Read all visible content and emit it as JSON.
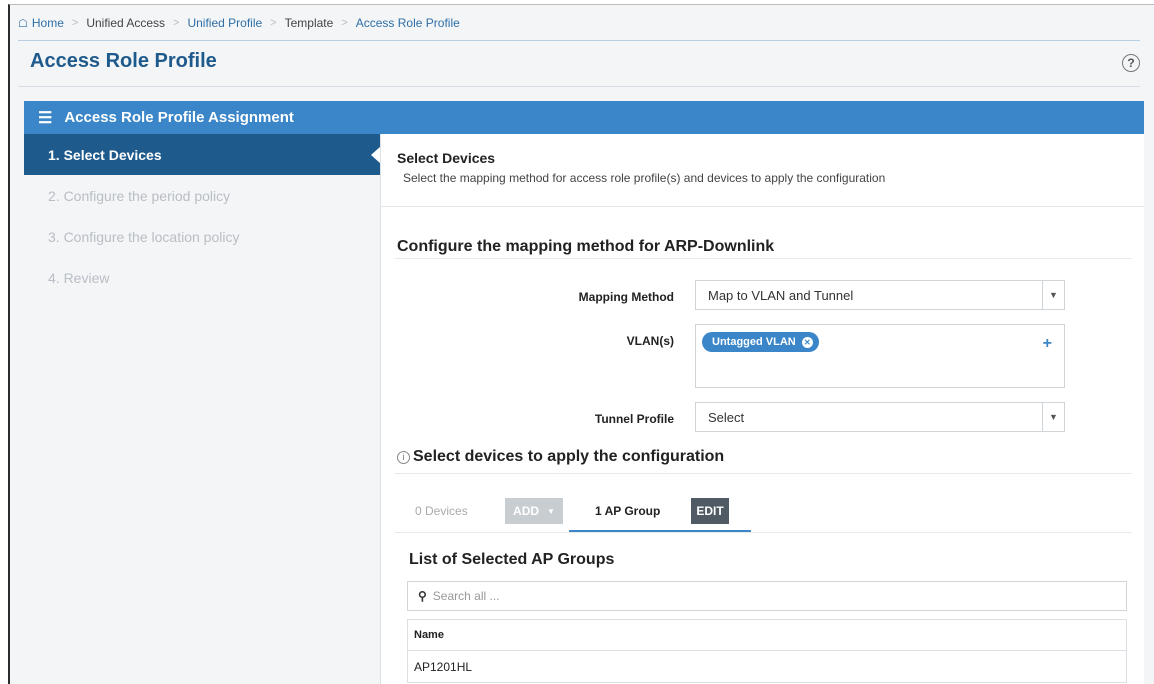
{
  "breadcrumb": {
    "items": [
      {
        "label": "Home",
        "link": true
      },
      {
        "label": "Unified Access",
        "link": true
      },
      {
        "label": "Unified Profile",
        "link": true
      },
      {
        "label": "Template",
        "link": false
      },
      {
        "label": "Access Role Profile",
        "link": true
      }
    ]
  },
  "page": {
    "title": "Access Role Profile",
    "help_icon": "?"
  },
  "wizard": {
    "header": "Access Role Profile Assignment",
    "steps": [
      {
        "label": "1. Select Devices",
        "active": true
      },
      {
        "label": "2. Configure the period policy",
        "active": false
      },
      {
        "label": "3. Configure the location policy",
        "active": false
      },
      {
        "label": "4. Review",
        "active": false
      }
    ]
  },
  "main": {
    "section_title": "Select Devices",
    "section_desc": "Select the mapping method for access role profile(s) and devices to apply the configuration",
    "mapping_title": "Configure the mapping method for ARP-Downlink",
    "mapping_method": {
      "label": "Mapping Method",
      "value": "Map to VLAN and Tunnel"
    },
    "vlans": {
      "label": "VLAN(s)",
      "tag": "Untagged VLAN",
      "add": "+"
    },
    "tunnel_profile": {
      "label": "Tunnel Profile",
      "value": "Select"
    },
    "devices_title": "Select devices to apply the configuration",
    "tabs": {
      "devices": "0 Devices",
      "add_button": "ADD",
      "ap_group": "1 AP Group",
      "edit_button": "EDIT"
    },
    "list_title": "List of Selected AP Groups",
    "search_placeholder": "Search all ...",
    "table": {
      "header": "Name",
      "rows": [
        "AP1201HL"
      ]
    }
  },
  "colors": {
    "accent": "#3a86c8",
    "active_step": "#1f5a8c",
    "title": "#1f5a8c"
  }
}
